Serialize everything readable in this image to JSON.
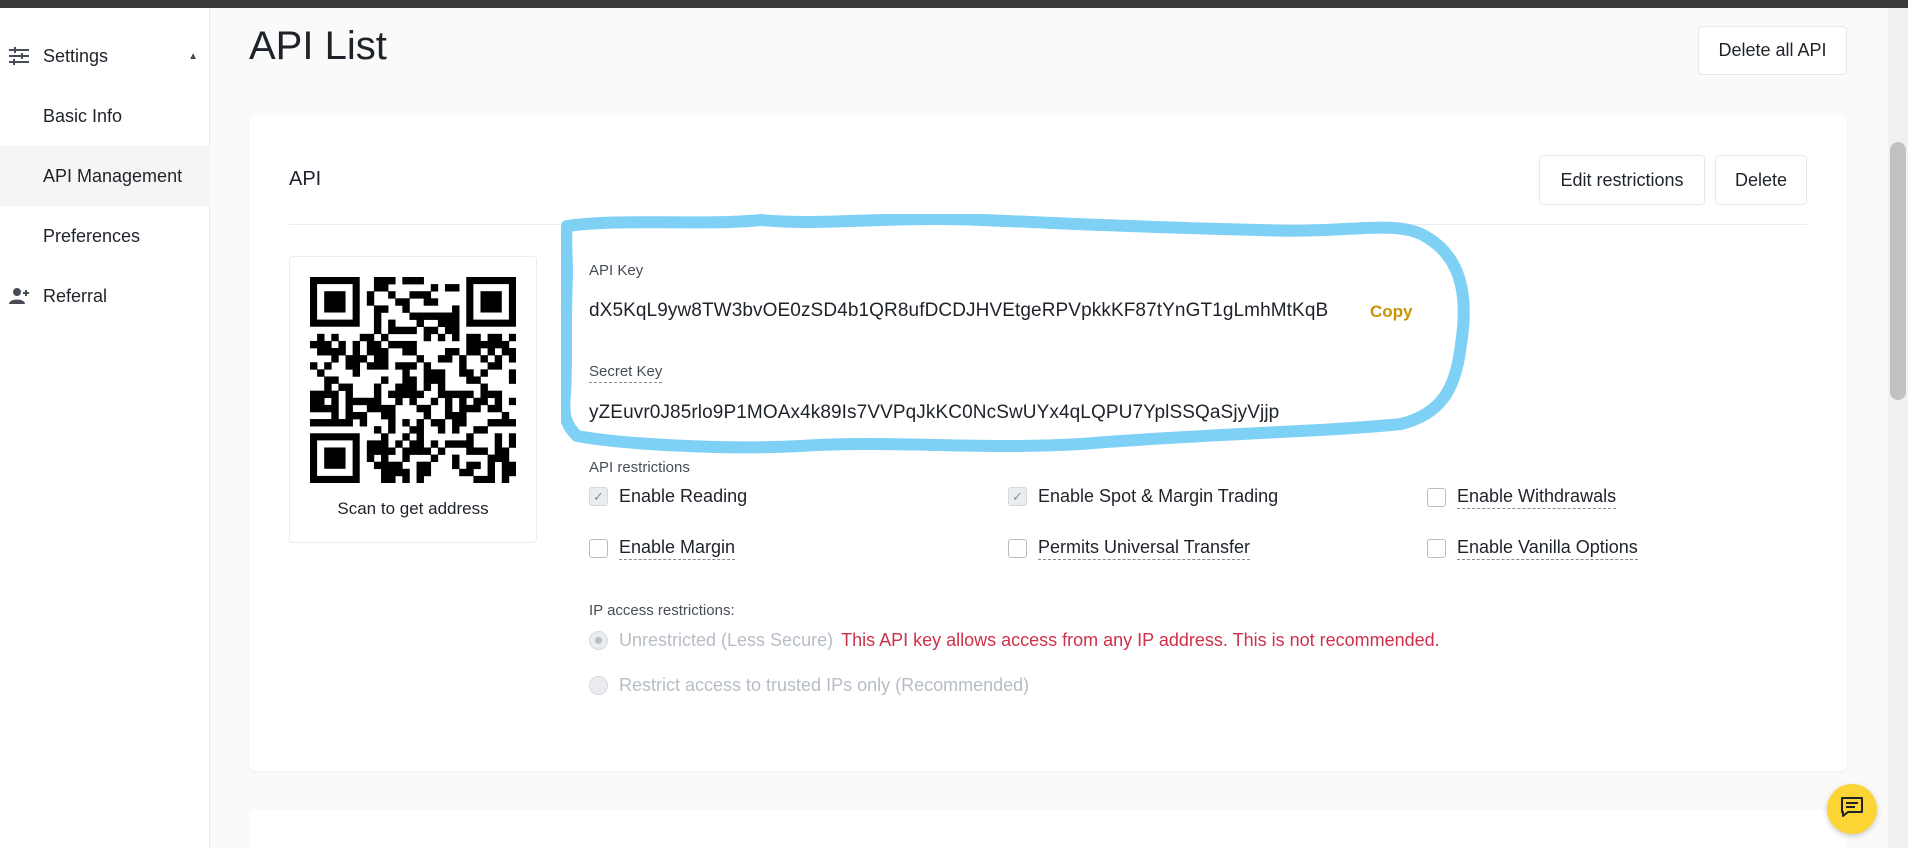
{
  "sidebar": {
    "settings": "Settings",
    "basic_info": "Basic Info",
    "api_management": "API Management",
    "preferences": "Preferences",
    "referral": "Referral"
  },
  "header": {
    "title": "API List",
    "delete_all": "Delete all API"
  },
  "card": {
    "title": "API",
    "edit_restrictions": "Edit restrictions",
    "delete": "Delete",
    "qr_caption": "Scan to get address",
    "api_key_label": "API Key",
    "api_key_value": "dX5KqL9yw8TW3bvOE0zSD4b1QR8ufDCDJHVEtgeRPVpkkKF87tYnGT1gLmhMtKqB",
    "copy": "Copy",
    "secret_key_label": "Secret Key",
    "secret_key_value": "yZEuvr0J85rlo9P1MOAx4k89Is7VVPqJkKC0NcSwUYx4qLQPU7YplSSQaSjyVjjp",
    "api_restrictions_label": "API restrictions",
    "restrictions": {
      "enable_reading": "Enable Reading",
      "enable_spot": "Enable Spot & Margin Trading",
      "enable_withdrawals": "Enable Withdrawals",
      "enable_margin": "Enable Margin",
      "universal_transfer": "Permits Universal Transfer",
      "vanilla_options": "Enable Vanilla Options"
    },
    "ip_label": "IP access restrictions:",
    "ip_unrestricted": "Unrestricted (Less Secure)",
    "ip_warning": "This API key allows access from any IP address. This is not recommended.",
    "ip_trusted": "Restrict access to trusted IPs only (Recommended)"
  },
  "colors": {
    "accent": "#c99400",
    "warning": "#cf304a",
    "highlight": "#7fd0f5",
    "fab": "#fcd535"
  }
}
